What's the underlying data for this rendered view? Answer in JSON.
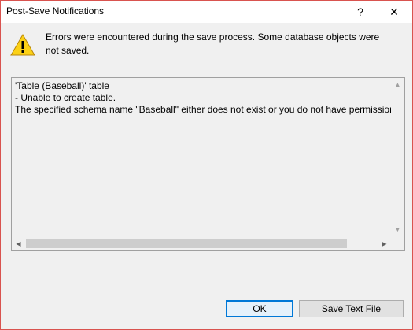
{
  "window": {
    "title": "Post-Save Notifications",
    "help_glyph": "?",
    "close_glyph": "✕"
  },
  "message": {
    "text": "Errors were encountered during the save process. Some database objects were not saved.",
    "icon": "warning-icon"
  },
  "details": {
    "lines": [
      "'Table (Baseball)' table",
      "- Unable to create table.",
      "The specified schema name \"Baseball\" either does not exist or you do not have permission"
    ]
  },
  "buttons": {
    "ok_label": "OK",
    "save_first": "S",
    "save_rest": "ave Text File"
  },
  "colors": {
    "window_border": "#d9534f",
    "default_button_border": "#0078d7",
    "warning_yellow": "#fcd116"
  }
}
